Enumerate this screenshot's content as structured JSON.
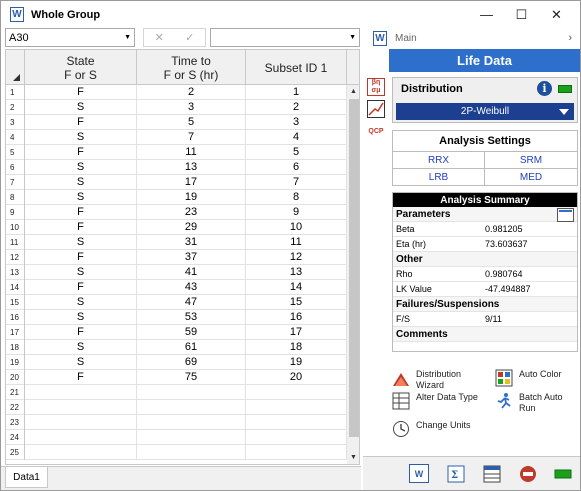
{
  "window": {
    "title": "Whole Group",
    "app_icon": "W",
    "controls": [
      "—",
      "☐",
      "✕"
    ]
  },
  "formula_bar": {
    "name_box": "A30",
    "cancel": "✕",
    "confirm": "✓",
    "formula": ""
  },
  "grid": {
    "columns": [
      {
        "line1": "State",
        "line2": "F or S"
      },
      {
        "line1": "Time to",
        "line2": "F or S (hr)"
      },
      {
        "line1": "Subset ID 1",
        "line2": ""
      }
    ],
    "rows": [
      {
        "n": "1",
        "state": "F",
        "time": "2",
        "subset": "1"
      },
      {
        "n": "2",
        "state": "S",
        "time": "3",
        "subset": "2"
      },
      {
        "n": "3",
        "state": "F",
        "time": "5",
        "subset": "3"
      },
      {
        "n": "4",
        "state": "S",
        "time": "7",
        "subset": "4"
      },
      {
        "n": "5",
        "state": "F",
        "time": "11",
        "subset": "5"
      },
      {
        "n": "6",
        "state": "S",
        "time": "13",
        "subset": "6"
      },
      {
        "n": "7",
        "state": "S",
        "time": "17",
        "subset": "7"
      },
      {
        "n": "8",
        "state": "S",
        "time": "19",
        "subset": "8"
      },
      {
        "n": "9",
        "state": "F",
        "time": "23",
        "subset": "9"
      },
      {
        "n": "10",
        "state": "F",
        "time": "29",
        "subset": "10"
      },
      {
        "n": "11",
        "state": "S",
        "time": "31",
        "subset": "11"
      },
      {
        "n": "12",
        "state": "F",
        "time": "37",
        "subset": "12"
      },
      {
        "n": "13",
        "state": "S",
        "time": "41",
        "subset": "13"
      },
      {
        "n": "14",
        "state": "F",
        "time": "43",
        "subset": "14"
      },
      {
        "n": "15",
        "state": "S",
        "time": "47",
        "subset": "15"
      },
      {
        "n": "16",
        "state": "S",
        "time": "53",
        "subset": "16"
      },
      {
        "n": "17",
        "state": "F",
        "time": "59",
        "subset": "17"
      },
      {
        "n": "18",
        "state": "S",
        "time": "61",
        "subset": "18"
      },
      {
        "n": "19",
        "state": "S",
        "time": "69",
        "subset": "19"
      },
      {
        "n": "20",
        "state": "F",
        "time": "75",
        "subset": "20"
      },
      {
        "n": "21",
        "state": "",
        "time": "",
        "subset": ""
      },
      {
        "n": "22",
        "state": "",
        "time": "",
        "subset": ""
      },
      {
        "n": "23",
        "state": "",
        "time": "",
        "subset": ""
      },
      {
        "n": "24",
        "state": "",
        "time": "",
        "subset": ""
      },
      {
        "n": "25",
        "state": "",
        "time": "",
        "subset": ""
      }
    ]
  },
  "sheet_tabs": [
    "Data1"
  ],
  "panel": {
    "header_label": "Main",
    "title": "Life Data",
    "side_icons": [
      "β η σ μ",
      "plot",
      "QCP"
    ],
    "distribution": {
      "label": "Distribution",
      "value": "2P-Weibull",
      "info": "i"
    },
    "analysis_settings": {
      "title": "Analysis Settings",
      "options": [
        "RRX",
        "SRM",
        "LRB",
        "MED"
      ]
    },
    "analysis_summary": {
      "title": "Analysis Summary",
      "parameters_label": "Parameters",
      "beta_label": "Beta",
      "beta_value": "0.981205",
      "eta_label": "Eta (hr)",
      "eta_value": "73.603637",
      "other_label": "Other",
      "rho_label": "Rho",
      "rho_value": "0.980764",
      "lk_label": "LK Value",
      "lk_value": "-47.494887",
      "fs_section_label": "Failures/Suspensions",
      "fs_label": "F/S",
      "fs_value": "9/11",
      "comments_label": "Comments"
    },
    "actions": {
      "distribution_wizard": "Distribution Wizard",
      "auto_color": "Auto Color",
      "alter_data_type": "Alter Data Type",
      "batch_auto_run": "Batch Auto Run",
      "change_units": "Change Units"
    }
  },
  "colors": {
    "accent": "#2d6fcb",
    "dropdown": "#1c3f8f",
    "link": "#1f3fc0",
    "indicator": "#1aa01a"
  }
}
